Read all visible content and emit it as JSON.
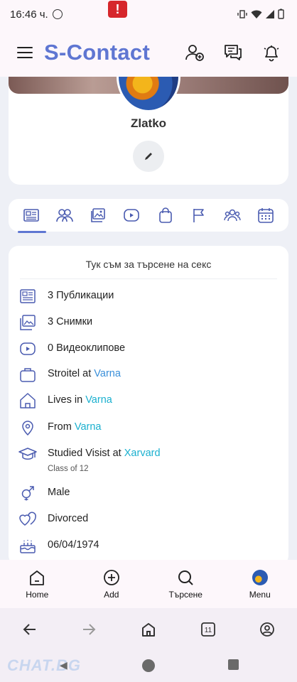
{
  "status_bar": {
    "time": "16:46 ч.",
    "alert": "!"
  },
  "app_bar": {
    "logo": "S-Contact"
  },
  "profile": {
    "name": "Zlatko"
  },
  "tabs": [
    {
      "icon": "publications-icon",
      "active": true
    },
    {
      "icon": "friends-icon"
    },
    {
      "icon": "photos-icon"
    },
    {
      "icon": "videos-icon"
    },
    {
      "icon": "shop-icon"
    },
    {
      "icon": "flag-icon"
    },
    {
      "icon": "groups-icon"
    },
    {
      "icon": "calendar-icon"
    }
  ],
  "about": {
    "bio": "Тук съм за търсене на секс",
    "publications": "3 Публикации",
    "photos": "3 Снимки",
    "videos": "0 Видеоклипове",
    "work_prefix": "Stroitel at ",
    "work_place": "Varna",
    "lives_prefix": "Lives in ",
    "lives_place": "Varna",
    "from_prefix": "From ",
    "from_place": "Varna",
    "studied_prefix": "Studied Visist at ",
    "studied_place": "Xarvard",
    "class_of": "Class of 12",
    "gender": "Male",
    "relationship": "Divorced",
    "birthday": "06/04/1974"
  },
  "bottom_nav": {
    "home": "Home",
    "add": "Add",
    "search": "Търсене",
    "menu": "Menu"
  },
  "browser_nav": {
    "tab_count": "11"
  },
  "watermark": "CHAT.BG",
  "colors": {
    "accent": "#5f76d2",
    "link": "#3a8fd9",
    "link_cyan": "#1ab0cf",
    "icon_blue": "#4a5bb0",
    "alert_red": "#d6262b"
  }
}
